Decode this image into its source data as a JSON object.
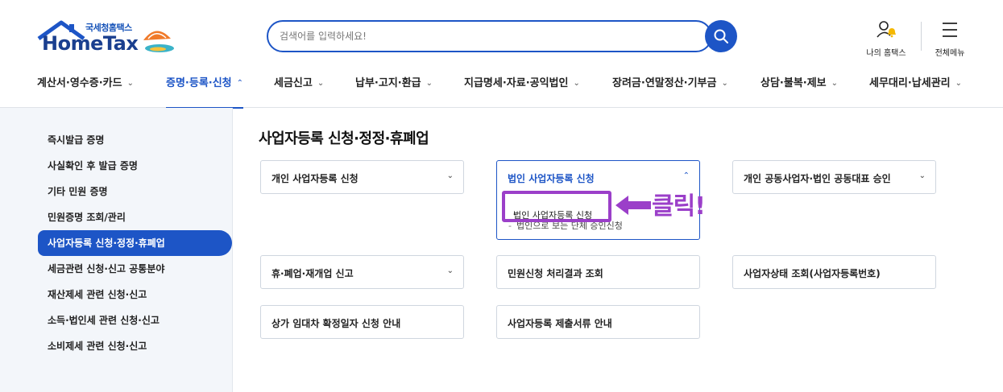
{
  "logo": {
    "top_text": "국세청홈택스",
    "main_text": "HomeTax"
  },
  "search": {
    "placeholder": "검색어를 입력하세요!"
  },
  "utilities": {
    "my_hometax": "나의 홈택스",
    "all_menu": "전체메뉴"
  },
  "gnb": [
    {
      "label": "계산서·영수증·카드",
      "state": "collapsed"
    },
    {
      "label": "증명·등록·신청",
      "state": "active"
    },
    {
      "label": "세금신고",
      "state": "collapsed"
    },
    {
      "label": "납부·고지·환급",
      "state": "collapsed"
    },
    {
      "label": "지급명세·자료·공익법인",
      "state": "collapsed"
    },
    {
      "label": "장려금·연말정산·기부금",
      "state": "collapsed"
    },
    {
      "label": "상담·불복·제보",
      "state": "collapsed"
    },
    {
      "label": "세무대리·납세관리",
      "state": "collapsed"
    }
  ],
  "sidebar": {
    "items": [
      {
        "label": "즉시발급 증명"
      },
      {
        "label": "사실확인 후 발급 증명"
      },
      {
        "label": "기타 민원 증명"
      },
      {
        "label": "민원증명 조회/관리"
      },
      {
        "label": "사업자등록 신청·정정·휴폐업"
      },
      {
        "label": "세금관련 신청·신고 공통분야"
      },
      {
        "label": "재산제세 관련 신청·신고"
      },
      {
        "label": "소득·법인세 관련 신청·신고"
      },
      {
        "label": "소비제세 관련 신청·신고"
      }
    ],
    "active_index": 4
  },
  "main": {
    "title": "사업자등록 신청·정정·휴폐업",
    "cards": [
      {
        "label": "개인 사업자등록 신청",
        "expandable": true
      },
      {
        "label": "법인 사업자등록 신청",
        "expandable": true,
        "expanded": true,
        "sub_items": [
          "법인 사업자등록 신청",
          "법인으로 보는 단체 승인신청"
        ]
      },
      {
        "label": "개인 공동사업자·법인 공동대표 승인",
        "expandable": true
      },
      {
        "label": "휴·폐업·재개업 신고",
        "expandable": true
      },
      {
        "label": "민원신청 처리결과 조회",
        "expandable": false
      },
      {
        "label": "사업자상태 조회(사업자등록번호)",
        "expandable": false
      },
      {
        "label": "상가 임대차 확정일자 신청 안내",
        "expandable": false
      },
      {
        "label": "사업자등록 제출서류 안내",
        "expandable": false
      }
    ]
  },
  "annotation": {
    "click_text": "클릭!",
    "color": "#9b3fc9"
  },
  "colors": {
    "primary": "#1d55c6",
    "sidebar_bg": "#f3f6fa",
    "annotation": "#9b3fc9"
  },
  "icons": {
    "search": "search-icon",
    "my_hometax": "user-bell-icon",
    "all_menu": "hamburger-icon",
    "expand": "chevron-down-icon",
    "collapse": "chevron-up-icon"
  }
}
